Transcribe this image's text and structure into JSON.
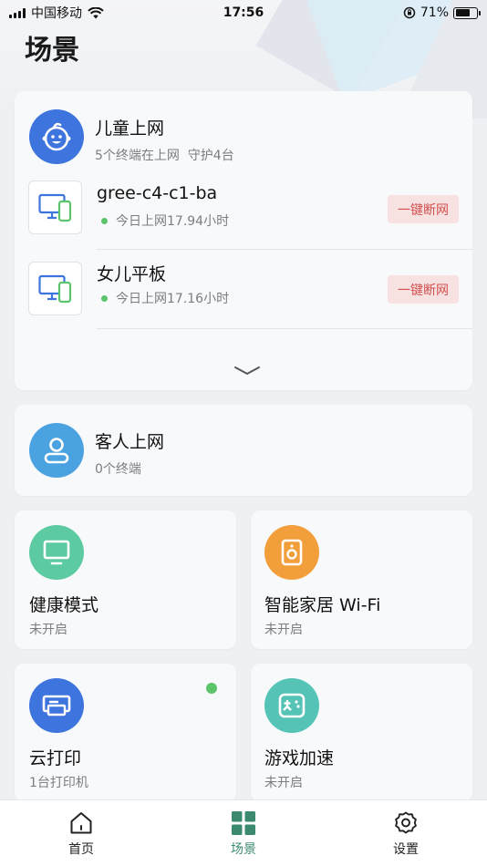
{
  "status_bar": {
    "carrier": "中国移动",
    "time": "17:56",
    "battery": "71%",
    "battery_level": 0.71
  },
  "page": {
    "title": "场景"
  },
  "child_card": {
    "title": "儿童上网",
    "subtitle": "5个终端在上网  守护4台",
    "devices": [
      {
        "name": "gree-c4-c1-ba",
        "usage": "今日上网17.94小时",
        "action": "一键断网"
      },
      {
        "name": "女儿平板",
        "usage": "今日上网17.16小时",
        "action": "一键断网"
      }
    ]
  },
  "guest_card": {
    "title": "客人上网",
    "subtitle": "0个终端"
  },
  "tiles": [
    {
      "title": "健康模式",
      "subtitle": "未开启",
      "icon": "tv-icon",
      "color": "#5ccba2"
    },
    {
      "title": "智能家居 Wi-Fi",
      "subtitle": "未开启",
      "icon": "speaker-icon",
      "color": "#f29f3b"
    },
    {
      "title": "云打印",
      "subtitle": "1台打印机",
      "icon": "printer-icon",
      "color": "#3d74dd"
    },
    {
      "title": "游戏加速",
      "subtitle": "未开启",
      "icon": "gamepad-icon",
      "color": "#55c4b6"
    }
  ],
  "colors": {
    "accent": "#3b8a6f",
    "child_avatar": "#3d74dd",
    "guest_avatar": "#4aa3e0",
    "online_dot": "#5cc46c",
    "danger": "#d2504e"
  },
  "tabbar": [
    {
      "label": "首页",
      "icon": "home-icon"
    },
    {
      "label": "场景",
      "icon": "grid-icon",
      "active": true
    },
    {
      "label": "设置",
      "icon": "gear-icon"
    }
  ]
}
